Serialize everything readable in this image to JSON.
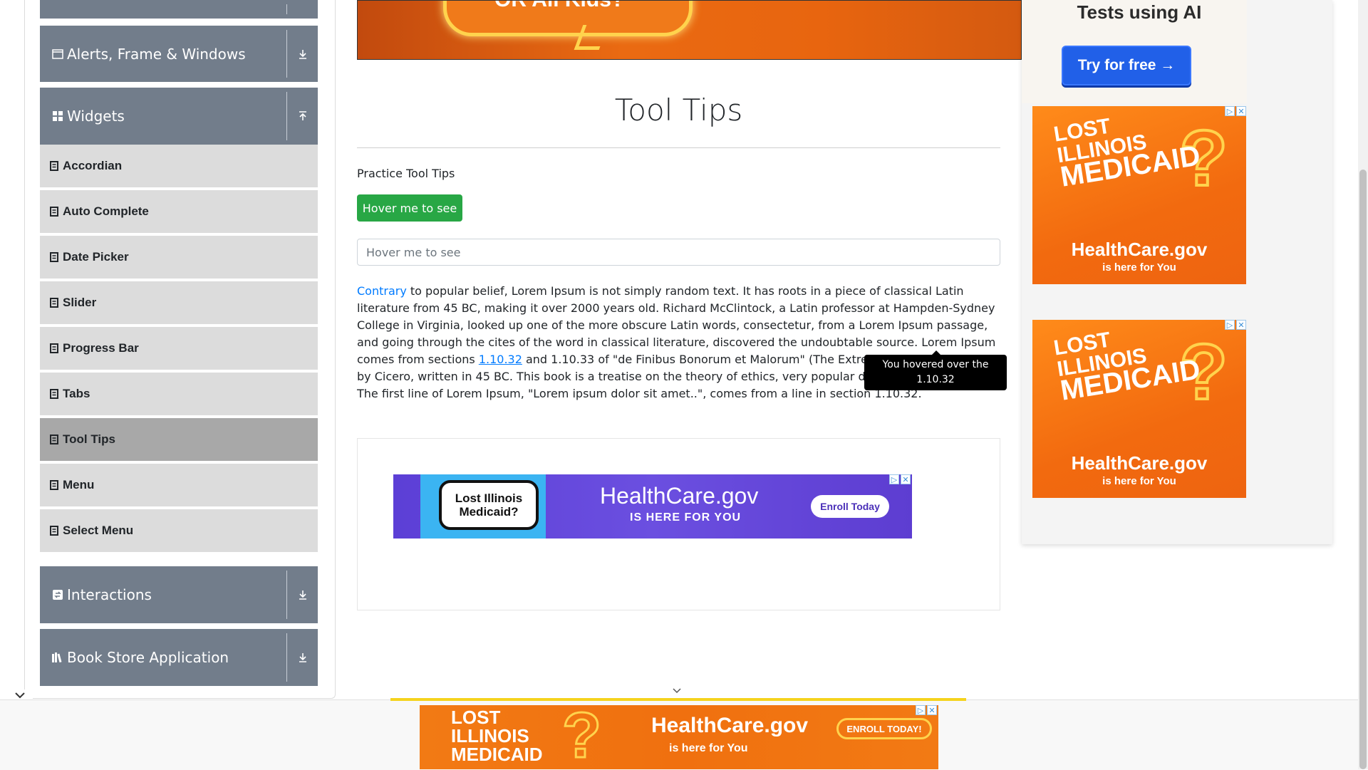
{
  "sidebar": {
    "groups": [
      {
        "label": "Alerts, Frame & Windows",
        "icon": "window-icon",
        "arrow": "download-icon"
      },
      {
        "label": "Widgets",
        "icon": "grid-icon",
        "arrow": "upload-icon"
      },
      {
        "label": "Interactions",
        "icon": "interactions-icon",
        "arrow": "download-icon"
      },
      {
        "label": "Book Store Application",
        "icon": "books-icon",
        "arrow": "download-icon"
      }
    ],
    "items": [
      {
        "label": "Accordian"
      },
      {
        "label": "Auto Complete"
      },
      {
        "label": "Date Picker"
      },
      {
        "label": "Slider"
      },
      {
        "label": "Progress Bar"
      },
      {
        "label": "Tabs"
      },
      {
        "label": "Tool Tips",
        "active": true
      },
      {
        "label": "Menu"
      },
      {
        "label": "Select Menu"
      }
    ]
  },
  "top_ad": {
    "text": "OR All Kids?"
  },
  "main": {
    "title": "Tool Tips",
    "practice_label": "Practice Tool Tips",
    "hover_button": "Hover me to see",
    "hover_input_placeholder": "Hover me to see",
    "paragraph": {
      "link_contrary": "Contrary",
      "text1": " to popular belief, Lorem Ipsum is not simply random text. It has roots in a piece of classical Latin literature from 45 BC, making it over 2000 years old. Richard McClintock, a Latin professor at Hampden-Sydney College in Virginia, looked up one of the more obscure Latin words, consectetur, from a Lorem Ipsum passage, and going through the cites of the word in classical literature, discovered the undoubtable source. Lorem Ipsum comes from sections ",
      "link_section": "1.10.32",
      "text2": " and 1.10.33 of \"de Finibus Bonorum et Malorum\" (The Extremes of Good and Evil) by Cicero, written in 45 BC. This book is a treatise on the theory of ethics, very popular during the Renaissance. The first line of Lorem Ipsum, \"Lorem ipsum dolor sit amet..\", comes from a line in section 1.10.32."
    },
    "tooltip": "You hovered over the 1.10.32"
  },
  "ads": {
    "hc_banner": {
      "bubble": "Lost Illinois Medicaid?",
      "logo": "HealthCare.gov",
      "sub": "IS HERE FOR YOU",
      "cta": "Enroll Today"
    },
    "right_top": {
      "headline": "Tests using AI",
      "cta": "Try for free →"
    },
    "orange": {
      "line1": "LOST",
      "line2": "ILLINOIS",
      "line3": "MEDICAID",
      "logo": "HealthCare.gov",
      "sub": "is here for You"
    },
    "bottom": {
      "line1": "LOST",
      "line2": "ILLINOIS",
      "line3": "MEDICAID",
      "logo": "HealthCare.gov",
      "sub": "is here for You",
      "cta": "ENROLL TODAY!"
    }
  },
  "colors": {
    "sidebar_group": "#727d8b",
    "sidebar_item": "#dcdcdc",
    "sidebar_active": "#a8a8a8",
    "button_green": "#28a745",
    "link_blue": "#007bff"
  }
}
